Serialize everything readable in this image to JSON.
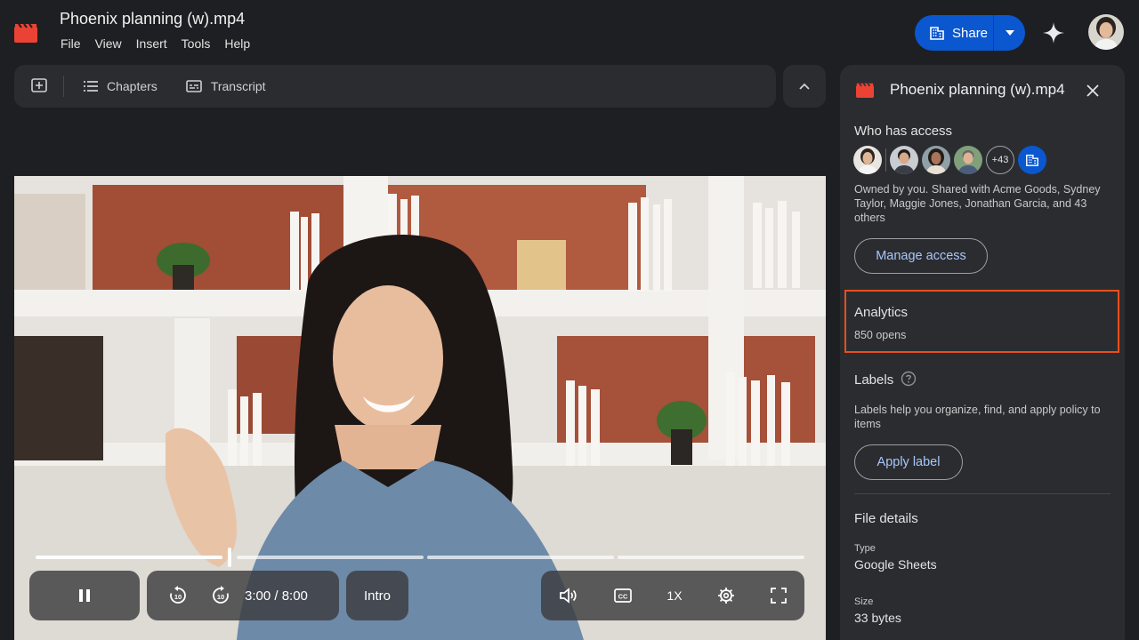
{
  "header": {
    "doc_title": "Phoenix planning (w).mp4",
    "menu": [
      "File",
      "View",
      "Insert",
      "Tools",
      "Help"
    ],
    "share_label": "Share",
    "share_icon": "building-icon",
    "gemini_icon": "sparkle-icon",
    "accent_color": "#0b57d0"
  },
  "toolbar": {
    "add_icon": "add-box-icon",
    "chapters_label": "Chapters",
    "transcript_label": "Transcript",
    "collapse_icon": "chevron-up-icon"
  },
  "player": {
    "progress_fraction": 0.375,
    "time_display": "3:00 / 8:00",
    "chapter_label": "Intro",
    "speed_label": "1X",
    "icons": [
      "pause-icon",
      "rewind-10-icon",
      "forward-10-icon",
      "volume-icon",
      "captions-icon",
      "settings-icon",
      "fullscreen-icon"
    ]
  },
  "details": {
    "title": "Phoenix planning (w).mp4",
    "who_has_access": "Who has access",
    "more_count": "+43",
    "access_text": "Owned by you. Shared with Acme Goods, Sydney Taylor, Maggie Jones, Jonathan Garcia, and 43 others",
    "manage_access": "Manage access",
    "analytics_title": "Analytics",
    "analytics_value": "850 opens",
    "highlight_color": "#e8501d",
    "labels_title": "Labels",
    "labels_text": "Labels help you organize, find, and apply policy to items",
    "apply_label": "Apply label",
    "file_details": "File details",
    "type_label": "Type",
    "type_value": "Google Sheets",
    "size_label": "Size",
    "size_value": "33 bytes"
  }
}
